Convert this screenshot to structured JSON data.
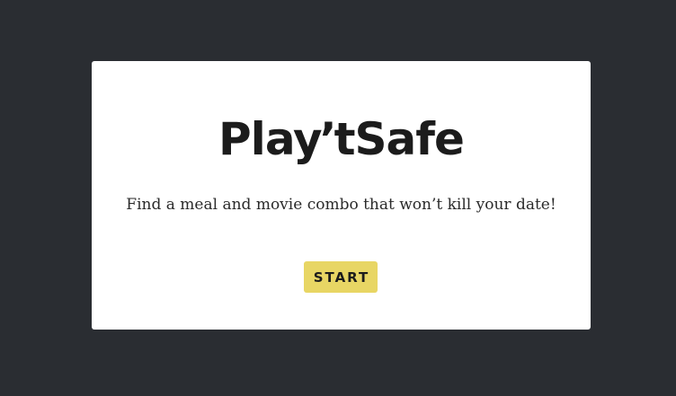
{
  "app": {
    "logo_part1": "Play",
    "logo_apostrophe": "’",
    "logo_part2": "tSafe",
    "tagline": "Find a meal and movie combo that won’t kill your date!",
    "start_label": "START"
  },
  "colors": {
    "background": "#2a2d32",
    "card": "#ffffff",
    "button": "#e8d664",
    "text": "#1c1c1c"
  }
}
